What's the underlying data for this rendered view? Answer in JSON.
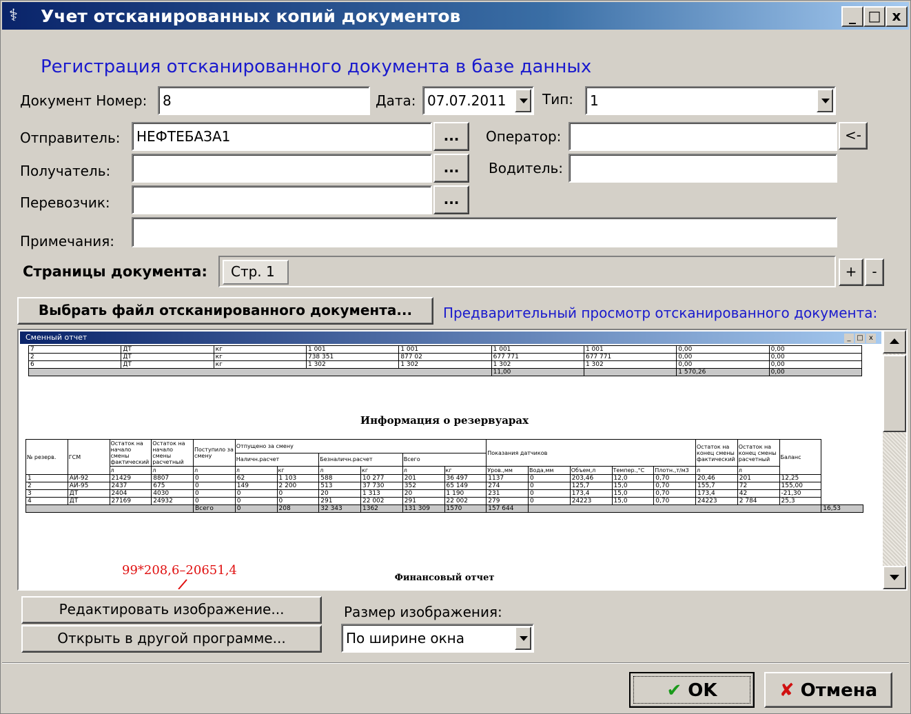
{
  "window": {
    "title": "Учет отсканированных копий документов",
    "controls": {
      "minimize": "_",
      "maximize": "□",
      "close": "x"
    }
  },
  "form": {
    "heading": "Регистрация отсканированного документа в базе данных",
    "doc_number": {
      "label": "Документ Номер:",
      "value": "8"
    },
    "date": {
      "label": "Дата:",
      "value": "07.07.2011"
    },
    "type": {
      "label": "Тип:",
      "value": "1"
    },
    "sender": {
      "label": "Отправитель:",
      "value": "НЕФТЕБАЗА1"
    },
    "receiver": {
      "label": "Получатель:",
      "value": ""
    },
    "carrier": {
      "label": "Перевозчик:",
      "value": ""
    },
    "operator": {
      "label": "Оператор:",
      "value": ""
    },
    "driver": {
      "label": "Водитель:",
      "value": ""
    },
    "notes": {
      "label": "Примечания:",
      "value": ""
    },
    "browse_label": "...",
    "operator_fill_label": "<-"
  },
  "pages": {
    "label": "Страницы документа:",
    "tabs": [
      "Стр. 1"
    ],
    "add_label": "+",
    "remove_label": "-"
  },
  "preview": {
    "select_file_label": "Выбрать файл отсканированного документа...",
    "caption": "Предварительный просмотр отсканированного документа:",
    "scan": {
      "window_title": "Сменный отчет",
      "top_rows": [
        [
          "7",
          "ДТ",
          "кг",
          "1 001",
          "1 001",
          "1 001",
          "1 001",
          "0,00",
          "0,00"
        ],
        [
          "2",
          "ДТ",
          "кг",
          "738 351",
          "877 02",
          "677 771",
          "677 771",
          "0,00",
          "0,00"
        ],
        [
          "6",
          "ДТ",
          "кг",
          "1 302",
          "1 302",
          "1 302",
          "1 302",
          "0,00",
          "0,00"
        ]
      ],
      "top_totals": [
        "11,00",
        "1 570,26",
        "0,00"
      ],
      "reservoir_title": "Информация о резервуарах",
      "reservoir_headers": {
        "num": "№ резерв.",
        "fuel": "ГСМ",
        "rest_fact": "Остаток на начало смены фактический",
        "rest_calc": "Остаток на начало смены расчетный",
        "received": "Поступило за смену",
        "shipped": "Отпущено за смену",
        "cash": "Наличн.расчет",
        "noncash": "Безналичн.расчет",
        "total": "Всего",
        "measure": "Показания датчиков",
        "level": "Уров.,мм",
        "water": "Вода,мм",
        "volume": "Объем,л",
        "temp": "Темпер.,°С",
        "density": "Плотн.,т/м3",
        "rest_end_fact": "Остаток на конец смены фактический",
        "rest_end_calc": "Остаток на конец смены расчетный",
        "balance": "Баланс",
        "unit_l": "л",
        "unit_kg": "кг"
      },
      "reservoir_rows": [
        [
          "1",
          "АИ-92",
          "21429",
          "8807",
          "0",
          "62",
          "1 103",
          "588",
          "10 277",
          "201",
          "36 497",
          "1137",
          "0",
          "203,46",
          "12,0",
          "0,70",
          "20,46",
          "201",
          "12,25"
        ],
        [
          "2",
          "АИ-95",
          "2437",
          "675",
          "0",
          "149",
          "2 200",
          "513",
          "37 730",
          "352",
          "65 149",
          "274",
          "0",
          "125,7",
          "15,0",
          "0,70",
          "155,7",
          "72",
          "155,00"
        ],
        [
          "3",
          "ДТ",
          "2404",
          "4030",
          "0",
          "0",
          "0",
          "20",
          "1 313",
          "20",
          "1 190",
          "231",
          "0",
          "173,4",
          "15,0",
          "0,70",
          "173,4",
          "42",
          "-21,30"
        ],
        [
          "4",
          "ДТ",
          "27169",
          "24932",
          "0",
          "0",
          "0",
          "291",
          "22 002",
          "291",
          "22 002",
          "279",
          "0",
          "24223",
          "15,0",
          "0,70",
          "24223",
          "2 784",
          "25,3"
        ]
      ],
      "reservoir_total_label": "Всего",
      "reservoir_totals": [
        "0",
        "208",
        "32 343",
        "1362",
        "131 309",
        "1570",
        "157 644",
        "16,53"
      ],
      "annotation": "99*208,6–20651,4",
      "finance_title": "Финансовый отчет"
    }
  },
  "image_controls": {
    "edit_label": "Редактировать изображение...",
    "open_external_label": "Открыть в другой программе...",
    "size_label": "Размер изображения:",
    "size_value": "По ширине окна"
  },
  "actions": {
    "ok_label": "OK",
    "cancel_label": "Отмена",
    "ok_check_color": "#1a9a1a",
    "cancel_x_color": "#d01010"
  }
}
